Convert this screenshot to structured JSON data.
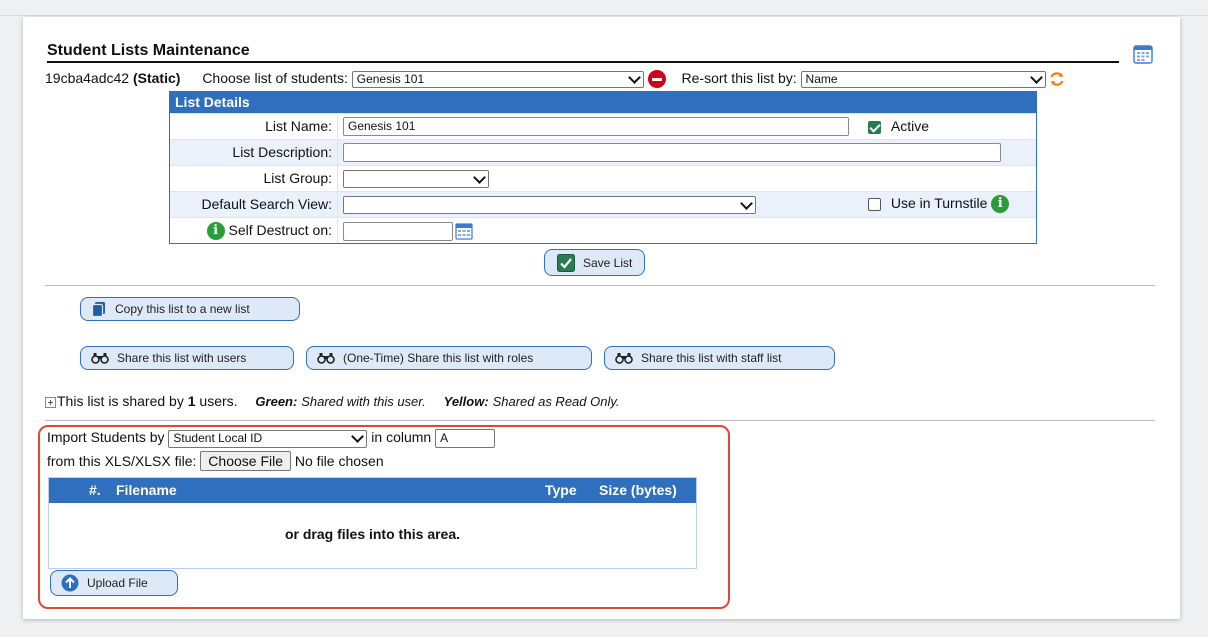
{
  "page": {
    "title": "Student Lists Maintenance",
    "list_id": "19cba4adc42",
    "list_type": "(Static)",
    "choose_label": "Choose list of students:",
    "choose_value": "Genesis 101",
    "resort_label": "Re-sort this list by:",
    "resort_value": "Name"
  },
  "details": {
    "header": "List Details",
    "list_name_label": "List Name:",
    "list_name_value": "Genesis 101",
    "active_label": "Active",
    "list_description_label": "List Description:",
    "list_description_value": "",
    "list_group_label": "List Group:",
    "list_group_value": "",
    "default_search_label": "Default Search View:",
    "default_search_value": "",
    "turnstile_label": "Use in Turnstile",
    "self_destruct_label": "Self Destruct on:",
    "self_destruct_value": "",
    "save_label": "Save List"
  },
  "actions": {
    "copy_label": "Copy this list to a new list",
    "share_users_label": "Share this list with users",
    "share_roles_label": "(One-Time) Share this list with roles",
    "share_staff_label": "Share this list with staff list"
  },
  "shared": {
    "prefix": "This list is shared by",
    "count": "1",
    "suffix": "users.",
    "green_label": "Green:",
    "green_text": "Shared with this user.",
    "yellow_label": "Yellow:",
    "yellow_text": "Shared as Read Only."
  },
  "import": {
    "by_label": "Import Students by",
    "by_value": "Student Local ID",
    "column_label": "in column",
    "column_value": "A",
    "file_label": "from this XLS/XLSX file:",
    "choose_file": "Choose File",
    "no_file": "No file chosen",
    "col_num": "#.",
    "col_filename": "Filename",
    "col_type": "Type",
    "col_size": "Size (bytes)",
    "drop_text": "or drag files into this area.",
    "upload_label": "Upload File"
  },
  "colors": {
    "accent": "#2f6fbd",
    "highlight_border": "#dc4a34",
    "active_check": "#2a7a52",
    "info": "#2a9d3a",
    "remove": "#d0021b"
  }
}
